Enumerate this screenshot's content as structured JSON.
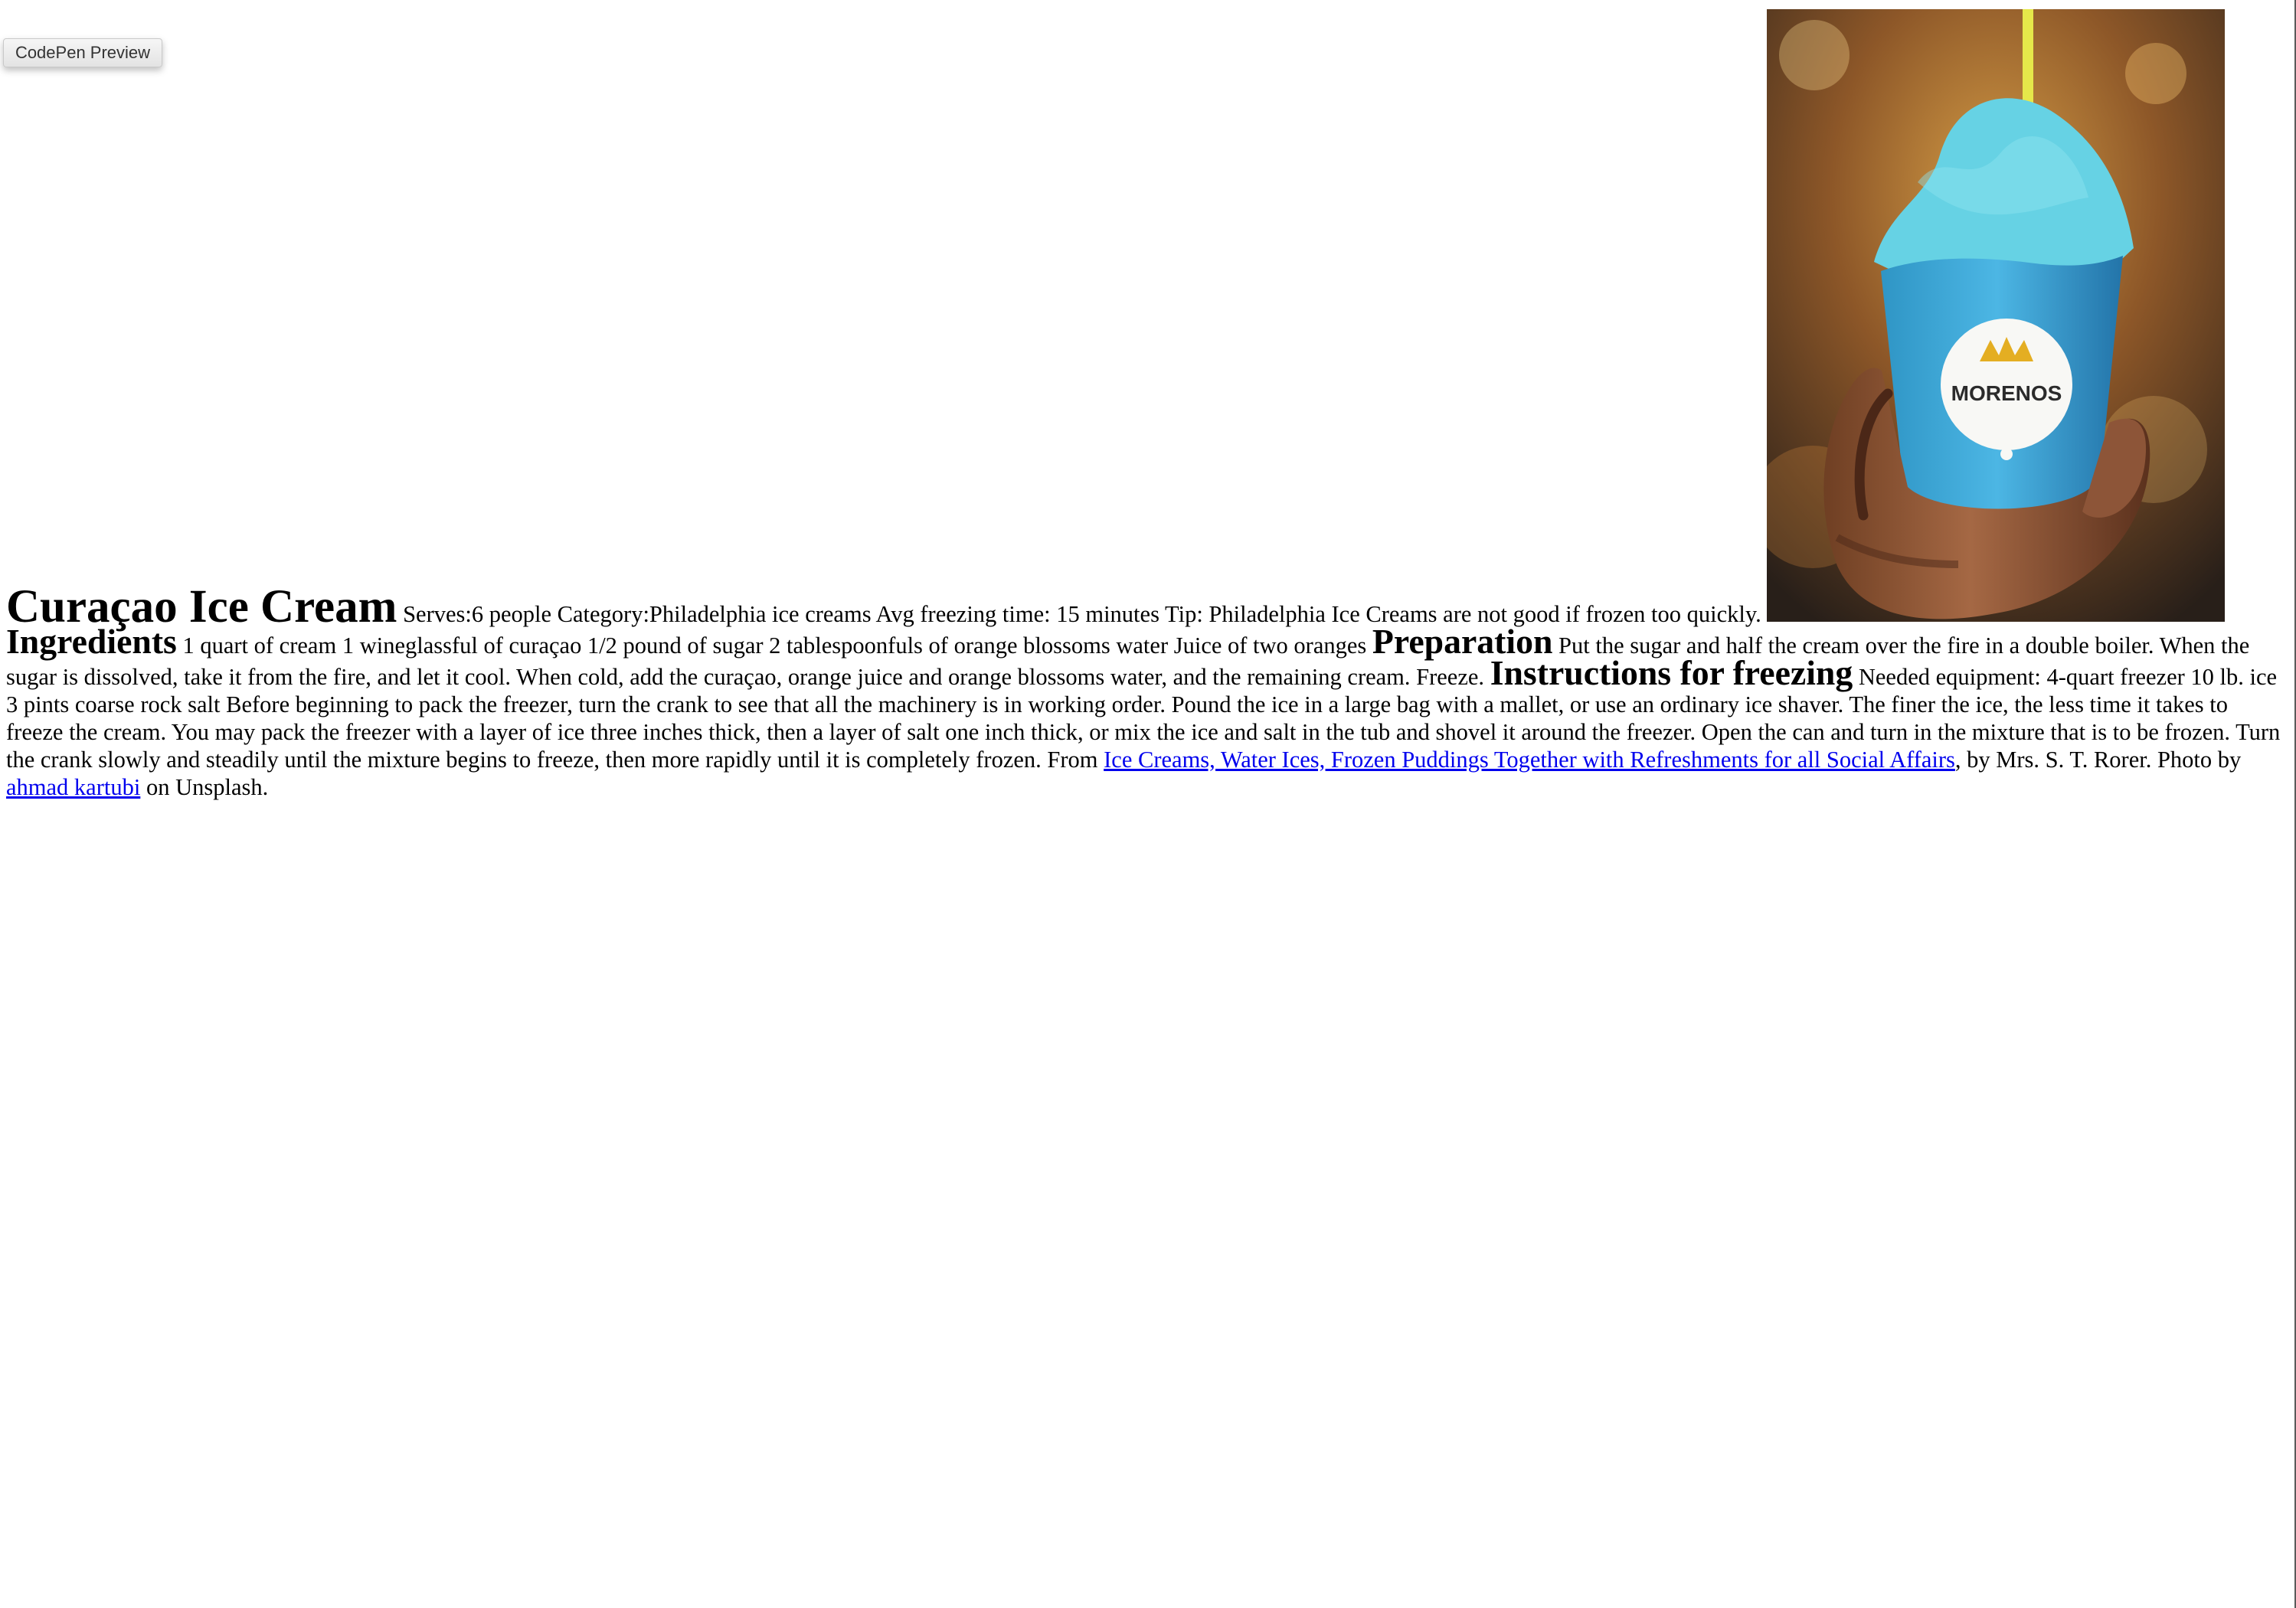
{
  "toolbar": {
    "preview_button": "CodePen Preview"
  },
  "recipe": {
    "title": "Curaçao Ice Cream",
    "serves": "Serves:6 people",
    "category": "Category:Philadelphia ice creams",
    "freezing_time": "Avg freezing time: 15 minutes",
    "tip": "Tip: Philadelphia Ice Creams are not good if frozen too quickly.",
    "photo": {
      "brand_text": "MORENOS",
      "icon": "crown-icon"
    },
    "ingredients_heading": "Ingredients",
    "ingredients": [
      "1 quart of cream",
      "1 wineglassful of curaçao",
      "1/2 pound of sugar",
      "2 tablespoonfuls of orange blossoms water",
      "Juice of two oranges"
    ],
    "preparation_heading": "Preparation",
    "preparation_text": "Put the sugar and half the cream over the fire in a double boiler. When the sugar is dissolved, take it from the fire, and let it cool. When cold, add the curaçao, orange juice and orange blossoms water, and the remaining cream. Freeze.",
    "instructions_heading": "Instructions for freezing",
    "equipment_heading": "Needed equipment:",
    "equipment": [
      "4-quart freezer",
      "10 lb. ice",
      "3 pints coarse rock salt"
    ],
    "freezing_text": "Before beginning to pack the freezer, turn the crank to see that all the machinery is in working order. Pound the ice in a large bag with a mallet, or use an ordinary ice shaver. The finer the ice, the less time it takes to freeze the cream. You may pack the freezer with a layer of ice three inches thick, then a layer of salt one inch thick, or mix the ice and salt in the tub and shovel it around the freezer. Open the can and turn in the mixture that is to be frozen. Turn the crank slowly and steadily until the mixture begins to freeze, then more rapidly until it is completely frozen.",
    "source_prefix": "From",
    "source_link": "Ice Creams, Water Ices, Frozen Puddings Together with Refreshments for all Social Affairs",
    "source_suffix": ", by Mrs. S. T. Rorer.",
    "photo_prefix": "Photo by",
    "photographer_link": "ahmad kartubi",
    "photo_suffix": "on Unsplash."
  },
  "colors": {
    "link": "#0000ee",
    "ice_cream": "#66d2e4",
    "cup": "#3ba6d7"
  }
}
